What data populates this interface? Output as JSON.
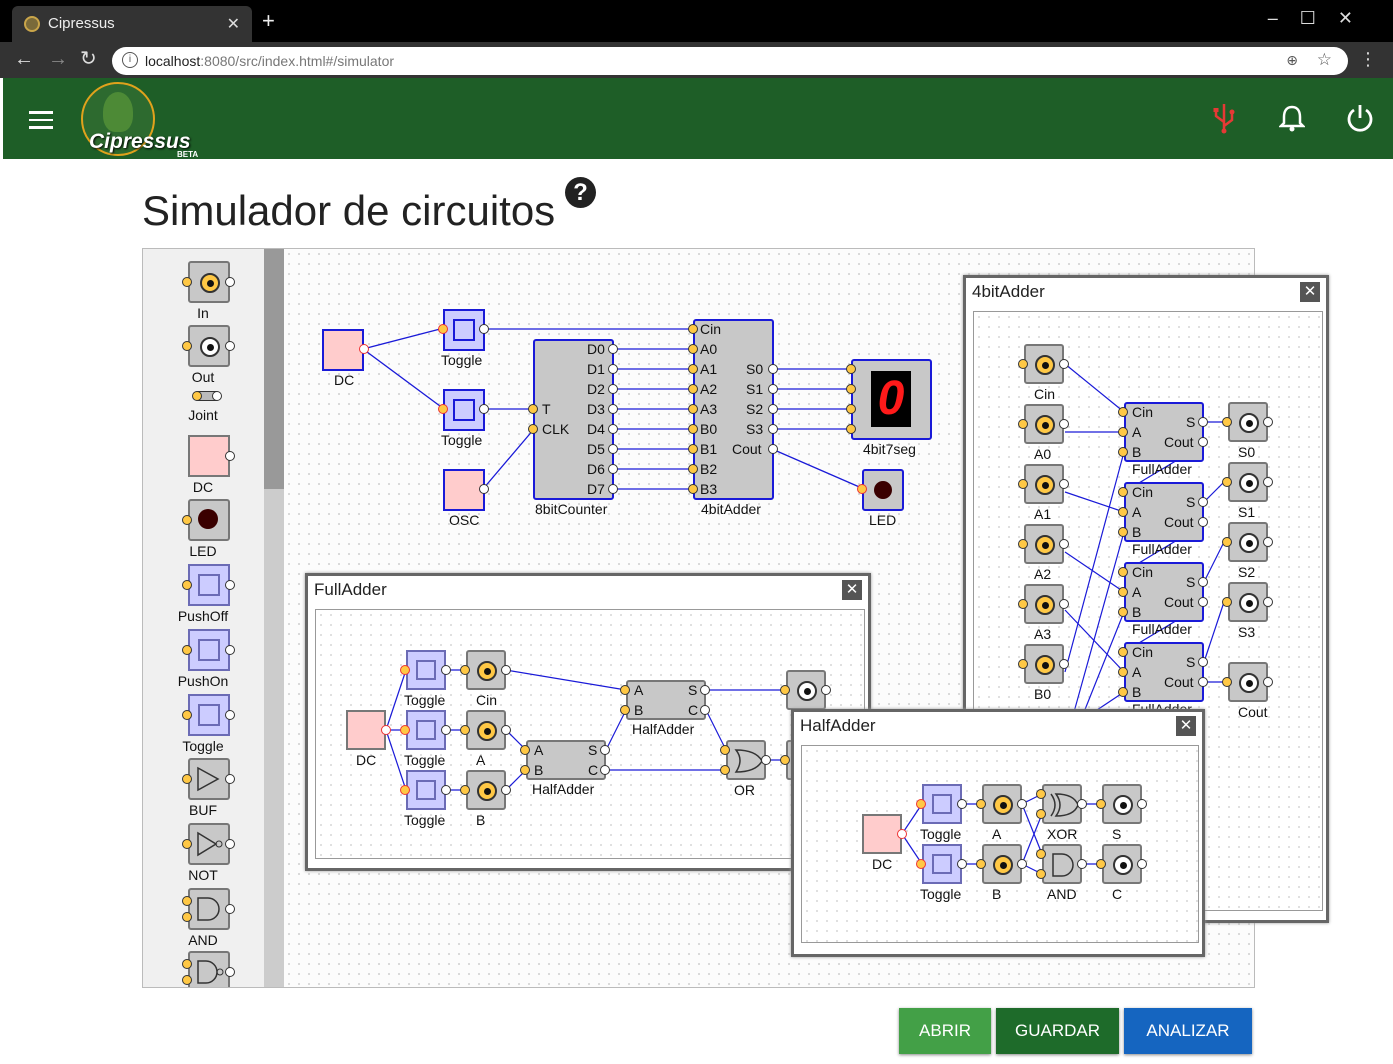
{
  "browser": {
    "tab_title": "Cipressus",
    "tab_close": "✕",
    "new_tab": "+",
    "url_host": "localhost",
    "url_path": ":8080/src/index.html#/simulator"
  },
  "appbar": {
    "logo_text": "Cipressus",
    "logo_badge": "BETA",
    "color": "#1e5e27"
  },
  "page": {
    "title": "Simulador de circuitos",
    "help": "?"
  },
  "palette": {
    "items": [
      {
        "label": "In",
        "icon": "input-icon"
      },
      {
        "label": "Out",
        "icon": "output-icon"
      },
      {
        "label": "Joint",
        "icon": "joint-icon"
      },
      {
        "label": "DC",
        "icon": "dc-icon"
      },
      {
        "label": "LED",
        "icon": "led-icon"
      },
      {
        "label": "PushOff",
        "icon": "pushoff-icon"
      },
      {
        "label": "PushOn",
        "icon": "pushon-icon"
      },
      {
        "label": "Toggle",
        "icon": "toggle-icon"
      },
      {
        "label": "BUF",
        "icon": "buf-gate-icon"
      },
      {
        "label": "NOT",
        "icon": "not-gate-icon"
      },
      {
        "label": "AND",
        "icon": "and-gate-icon"
      }
    ]
  },
  "circuit": {
    "dc": "DC",
    "toggle1": "Toggle",
    "toggle2": "Toggle",
    "osc": "OSC",
    "counter": "8bitCounter",
    "counter_in": [
      "T",
      "CLK"
    ],
    "counter_out": [
      "D0",
      "D1",
      "D2",
      "D3",
      "D4",
      "D5",
      "D6",
      "D7"
    ],
    "adder": "4bitAdder",
    "adder_in": [
      "Cin",
      "A0",
      "A1",
      "A2",
      "A3",
      "B0",
      "B1",
      "B2",
      "B3"
    ],
    "adder_out": [
      "S0",
      "S1",
      "S2",
      "S3",
      "Cout"
    ],
    "seg": "4bit7seg",
    "seg_digit": "0",
    "led": "LED"
  },
  "win_4bit": {
    "title": "4bitAdder",
    "close": "✕",
    "inputs": [
      "Cin",
      "A0",
      "A1",
      "A2",
      "A3",
      "B0"
    ],
    "fa_pins": [
      "Cin",
      "A",
      "B",
      "S",
      "Cout"
    ],
    "fa_label": "FullAdder",
    "outputs": [
      "S0",
      "S1",
      "S2",
      "S3",
      "Cout"
    ]
  },
  "win_full": {
    "title": "FullAdder",
    "close": "✕",
    "dc": "DC",
    "toggles": [
      "Toggle",
      "Toggle",
      "Toggle"
    ],
    "inputs": [
      "Cin",
      "A",
      "B"
    ],
    "ha_pins": [
      "A",
      "B",
      "S",
      "C"
    ],
    "ha_label": "HalfAdder",
    "or": "OR"
  },
  "win_half": {
    "title": "HalfAdder",
    "close": "✕",
    "dc": "DC",
    "toggles": [
      "Toggle",
      "Toggle"
    ],
    "inputs": [
      "A",
      "B"
    ],
    "gates": [
      "XOR",
      "AND"
    ],
    "outputs": [
      "S",
      "C"
    ]
  },
  "buttons": {
    "open": "ABRIR",
    "save": "GUARDAR",
    "analyze": "ANALIZAR"
  }
}
